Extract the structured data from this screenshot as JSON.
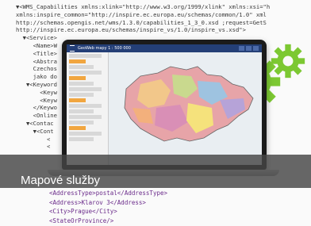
{
  "card": {
    "caption": "Mapové služby"
  },
  "xml_lines": [
    "▼<WMS_Capabilities xmlns:xlink=\"http://www.w3.org/1999/xlink\" xmlns:xsi=\"h",
    "xmlns:inspire_common=\"http://inspire.ec.europa.eu/schemas/common/1.0\" xml",
    "http://schemas.opengis.net/wms/1.3.0/capabilities_1_3_0.xsd ;request=GetS",
    "http://inspire.ec.europa.eu/schemas/inspire_vs/1.0/inspire_vs.xsd\">",
    "  ▼<Service>",
    "     <Name>W",
    "     <Title>",
    "     <Abstra",
    "     Czechos",
    "     jako do",
    "   ▼<Keyword",
    "       <Keyw",
    "       <Keyw",
    "     </Keywo",
    "     <Online",
    "   ▼<Contac",
    "     ▼<Cont",
    "         <",
    "         <"
  ],
  "xml_bottom_lines": [
    "<AddressType>postal</AddressType>",
    "<Address>Klarov 3</Address>",
    "<City>Prague</City>",
    "<StateOrProvince/>"
  ],
  "app": {
    "title": "GeoWeb mapy 1 : 500 000"
  },
  "colors": {
    "gear": "#7cc832",
    "app_header": "#243f77",
    "caption_bg": "#464646"
  }
}
